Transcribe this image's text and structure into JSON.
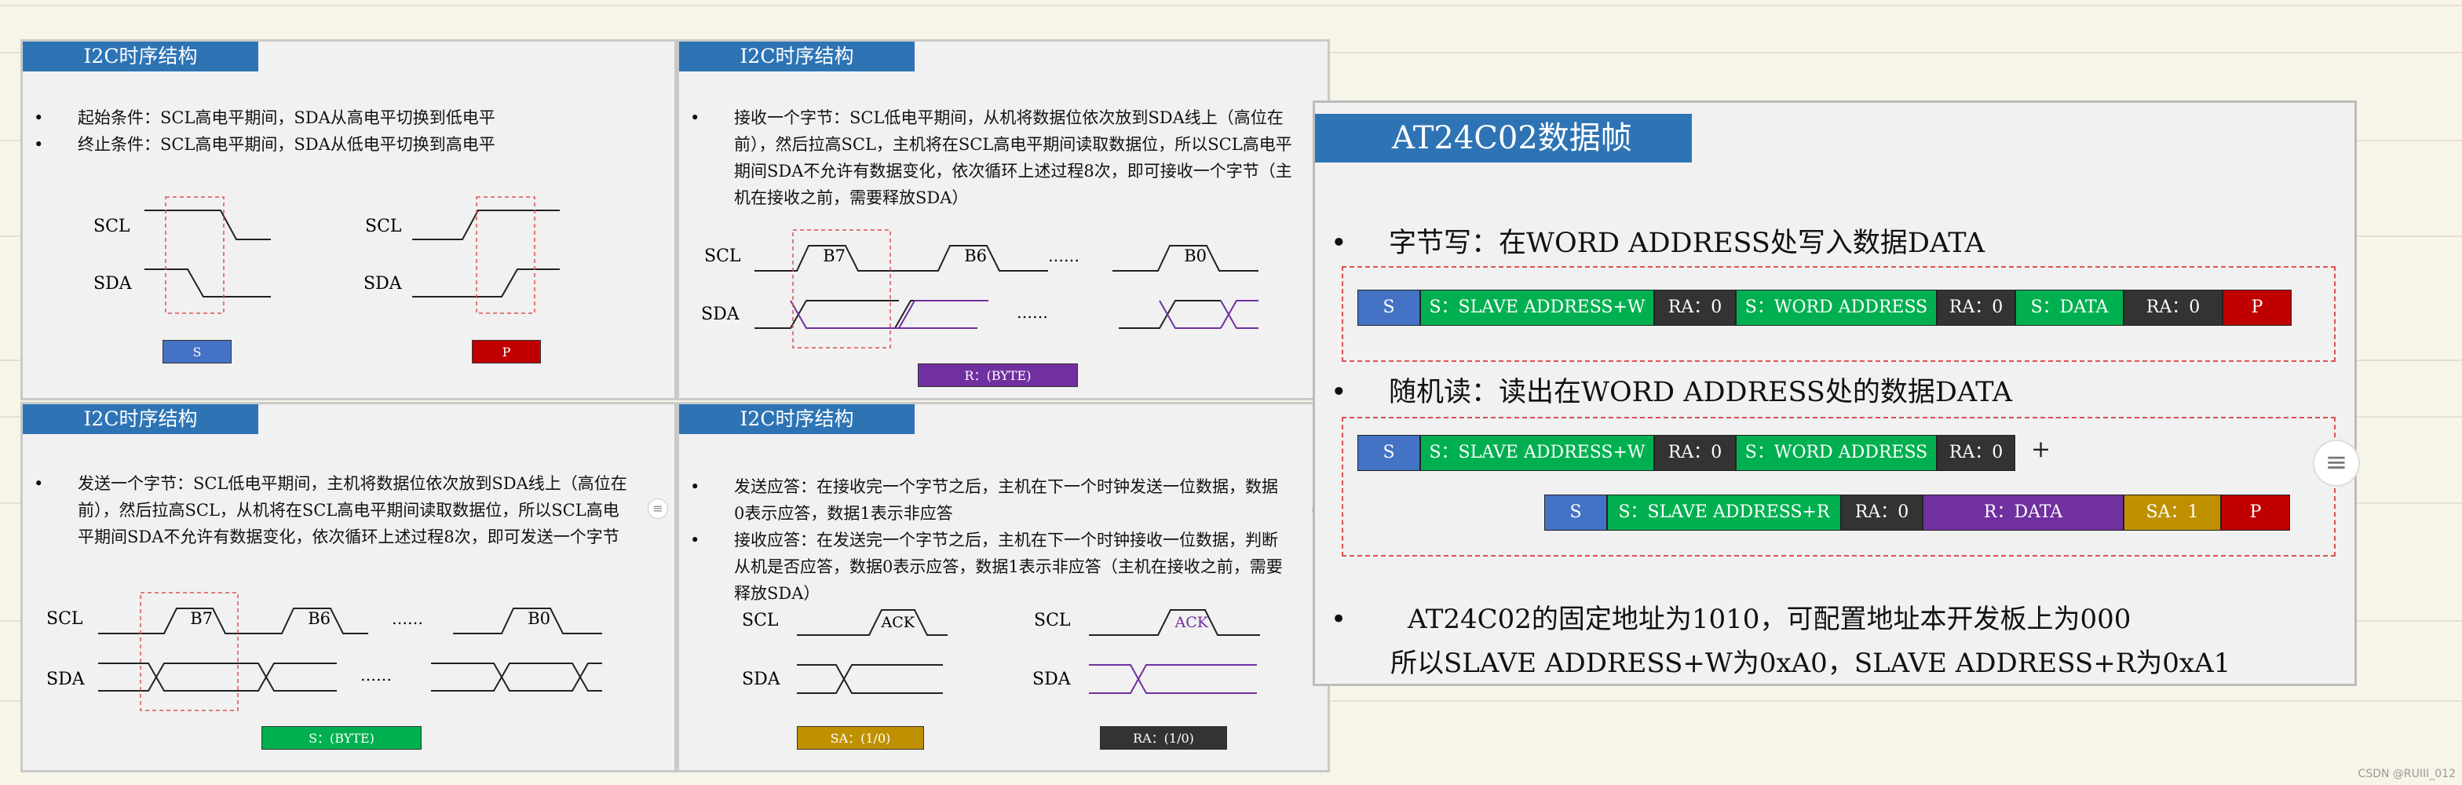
{
  "watermark": "CSDN @RUIII_012",
  "slide_start_stop": {
    "title": "I2C时序结构",
    "bullets": [
      "起始条件：SCL高电平期间，SDA从高电平切换到低电平",
      "终止条件：SCL高电平期间，SDA从低电平切换到高电平"
    ],
    "scl": "SCL",
    "sda": "SDA",
    "tag_s": "S",
    "tag_p": "P",
    "colors": {
      "s": "#4472c4",
      "p": "#c00000"
    }
  },
  "slide_receive": {
    "title": "I2C时序结构",
    "bullets": [
      "接收一个字节：SCL低电平期间，从机将数据位依次放到SDA线上（高位在前），然后拉高SCL，主机将在SCL高电平期间读取数据位，所以SCL高电平期间SDA不允许有数据变化，依次循环上述过程8次，即可接收一个字节（主机在接收之前，需要释放SDA）"
    ],
    "scl": "SCL",
    "sda": "SDA",
    "b7": "B7",
    "b6": "B6",
    "b0": "B0",
    "dots": "……",
    "tag": "R：(BYTE)",
    "tag_color": "#7030a0"
  },
  "slide_send": {
    "title": "I2C时序结构",
    "bullets": [
      "发送一个字节：SCL低电平期间，主机将数据位依次放到SDA线上（高位在前），然后拉高SCL，从机将在SCL高电平期间读取数据位，所以SCL高电平期间SDA不允许有数据变化，依次循环上述过程8次，即可发送一个字节"
    ],
    "scl": "SCL",
    "sda": "SDA",
    "b7": "B7",
    "b6": "B6",
    "b0": "B0",
    "dots": "……",
    "tag": "S：(BYTE)",
    "tag_color": "#00b050"
  },
  "slide_ack": {
    "title": "I2C时序结构",
    "bullets": [
      "发送应答：在接收完一个字节之后，主机在下一个时钟发送一位数据，数据0表示应答，数据1表示非应答",
      "接收应答：在发送完一个字节之后，主机在下一个时钟接收一位数据，判断从机是否应答，数据0表示应答，数据1表示非应答（主机在接收之前，需要释放SDA）"
    ],
    "scl": "SCL",
    "sda": "SDA",
    "ack": "ACK",
    "tag_sa": "SA：(1/0)",
    "tag_ra": "RA：(1/0)",
    "colors": {
      "sa": "#bf9000",
      "ra": "#333333"
    }
  },
  "at24c02": {
    "title": "AT24C02数据帧",
    "byte_write": "字节写：在WORD ADDRESS处写入数据DATA",
    "random_read": "随机读：读出在WORD ADDRESS处的数据DATA",
    "plus": "+",
    "note_line1": "AT24C02的固定地址为1010，可配置地址本开发板上为000",
    "note_line2": "所以SLAVE ADDRESS+W为0xA0，SLAVE ADDRESS+R为0xA1",
    "write_frame": [
      {
        "label": "S",
        "color": "#4472c4"
      },
      {
        "label": "S：SLAVE ADDRESS+W",
        "color": "#00b050"
      },
      {
        "label": "RA：0",
        "color": "#333333"
      },
      {
        "label": "S：WORD ADDRESS",
        "color": "#00b050"
      },
      {
        "label": "RA：0",
        "color": "#333333"
      },
      {
        "label": "S：DATA",
        "color": "#00b050"
      },
      {
        "label": "RA：0",
        "color": "#333333"
      },
      {
        "label": "P",
        "color": "#c00000"
      }
    ],
    "read_frame_1": [
      {
        "label": "S",
        "color": "#4472c4"
      },
      {
        "label": "S：SLAVE ADDRESS+W",
        "color": "#00b050"
      },
      {
        "label": "RA：0",
        "color": "#333333"
      },
      {
        "label": "S：WORD ADDRESS",
        "color": "#00b050"
      },
      {
        "label": "RA：0",
        "color": "#333333"
      }
    ],
    "read_frame_2": [
      {
        "label": "S",
        "color": "#4472c4"
      },
      {
        "label": "S：SLAVE ADDRESS+R",
        "color": "#00b050"
      },
      {
        "label": "RA：0",
        "color": "#333333"
      },
      {
        "label": "R：DATA",
        "color": "#7030a0"
      },
      {
        "label": "SA：1",
        "color": "#bf9000"
      },
      {
        "label": "P",
        "color": "#c00000"
      }
    ]
  }
}
